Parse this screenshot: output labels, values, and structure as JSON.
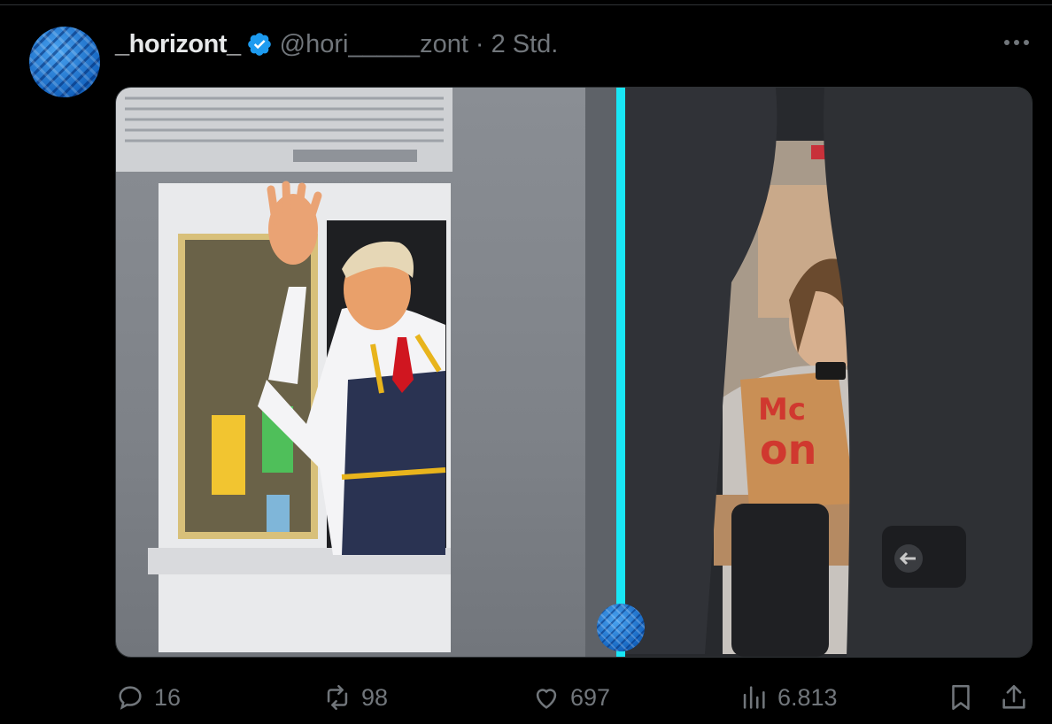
{
  "tweet": {
    "author": {
      "display_name": "_horizont_",
      "verified_icon": "verified-badge-icon",
      "handle": "@hori_____zont",
      "separator": "·",
      "time": "2 Std."
    },
    "media": {
      "left_image": "photo-drive-thru-window-waving",
      "right_image": "photo-train-passenger-with-mcdonalds-bag",
      "divider_color": "#19e6f5"
    },
    "actions": {
      "reply": {
        "icon": "reply-icon",
        "count": "16"
      },
      "retweet": {
        "icon": "retweet-icon",
        "count": "98"
      },
      "like": {
        "icon": "heart-icon",
        "count": "697"
      },
      "views": {
        "icon": "views-icon",
        "count": "6.813"
      },
      "bookmark": {
        "icon": "bookmark-icon"
      },
      "share": {
        "icon": "share-icon"
      }
    },
    "more_icon": "more-icon"
  },
  "colors": {
    "background": "#000000",
    "text_primary": "#e7e9ea",
    "text_secondary": "#71767b",
    "verified_blue": "#1d9bf0",
    "divider_cyan": "#19e6f5"
  }
}
